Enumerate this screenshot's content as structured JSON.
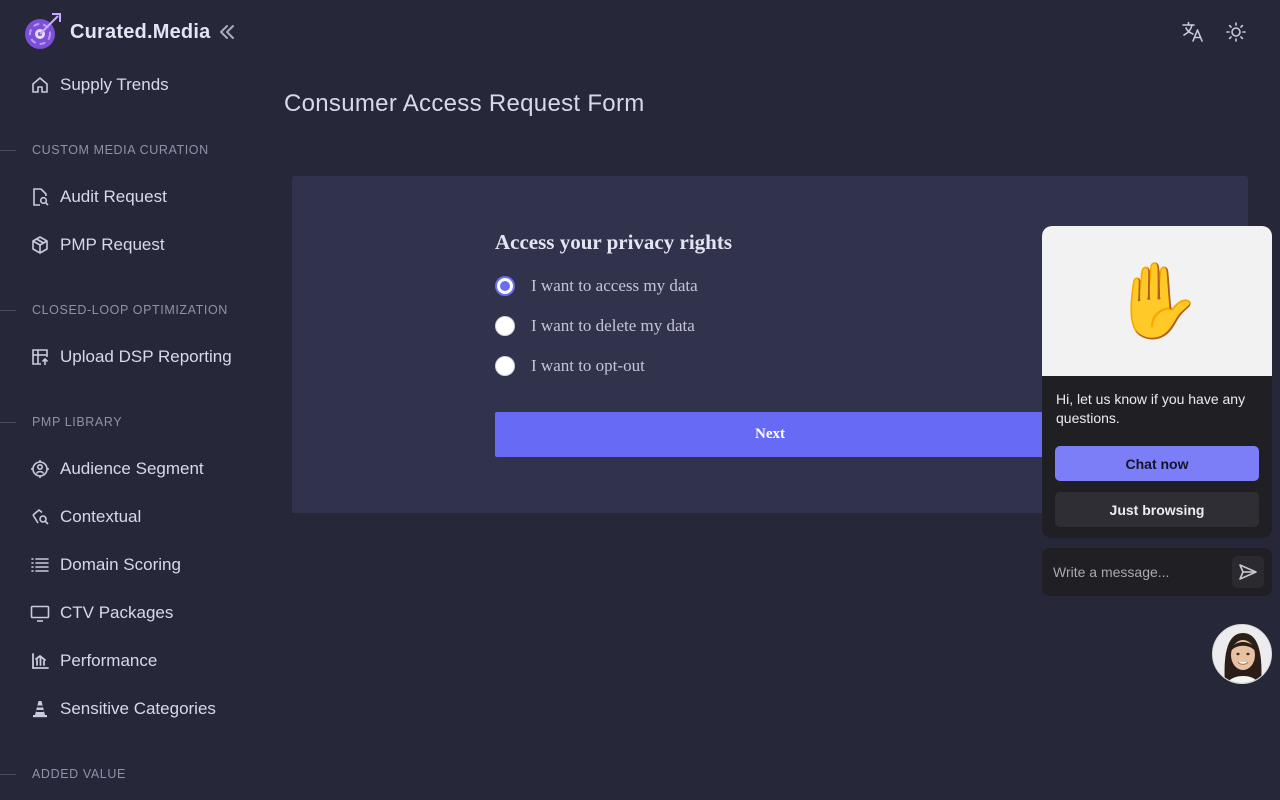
{
  "app": {
    "name": "Curated.Media"
  },
  "sidebar": {
    "top_item": {
      "label": "Supply Trends",
      "icon": "home-icon"
    },
    "sections": [
      {
        "title": "CUSTOM MEDIA CURATION",
        "items": [
          {
            "label": "Audit Request",
            "icon": "document-search-icon"
          },
          {
            "label": "PMP Request",
            "icon": "package-icon"
          }
        ]
      },
      {
        "title": "CLOSED-LOOP OPTIMIZATION",
        "items": [
          {
            "label": "Upload DSP Reporting",
            "icon": "table-upload-icon"
          }
        ]
      },
      {
        "title": "PMP LIBRARY",
        "items": [
          {
            "label": "Audience Segment",
            "icon": "target-user-icon"
          },
          {
            "label": "Contextual",
            "icon": "contextual-search-icon"
          },
          {
            "label": "Domain Scoring",
            "icon": "list-icon"
          },
          {
            "label": "CTV Packages",
            "icon": "tv-icon"
          },
          {
            "label": "Performance",
            "icon": "bar-chart-icon"
          },
          {
            "label": "Sensitive Categories",
            "icon": "traffic-cone-icon"
          }
        ]
      },
      {
        "title": "ADDED VALUE",
        "items": []
      }
    ]
  },
  "header": {
    "icons": [
      "translate-icon",
      "sun-icon"
    ]
  },
  "main": {
    "page_title": "Consumer Access Request Form",
    "form": {
      "heading": "Access your privacy rights",
      "options": [
        {
          "label": "I want to access my data",
          "checked": true
        },
        {
          "label": "I want to delete my data",
          "checked": false
        },
        {
          "label": "I want to opt-out",
          "checked": false
        }
      ],
      "next_label": "Next"
    }
  },
  "chat": {
    "greeting_emoji": "✋",
    "message": "Hi, let us know if you have any questions.",
    "primary_button": "Chat now",
    "secondary_button": "Just browsing",
    "input_placeholder": "Write a message..."
  },
  "colors": {
    "background": "#262839",
    "card": "#31334d",
    "accent": "#676af5",
    "chat_accent": "#7b7ef7"
  }
}
